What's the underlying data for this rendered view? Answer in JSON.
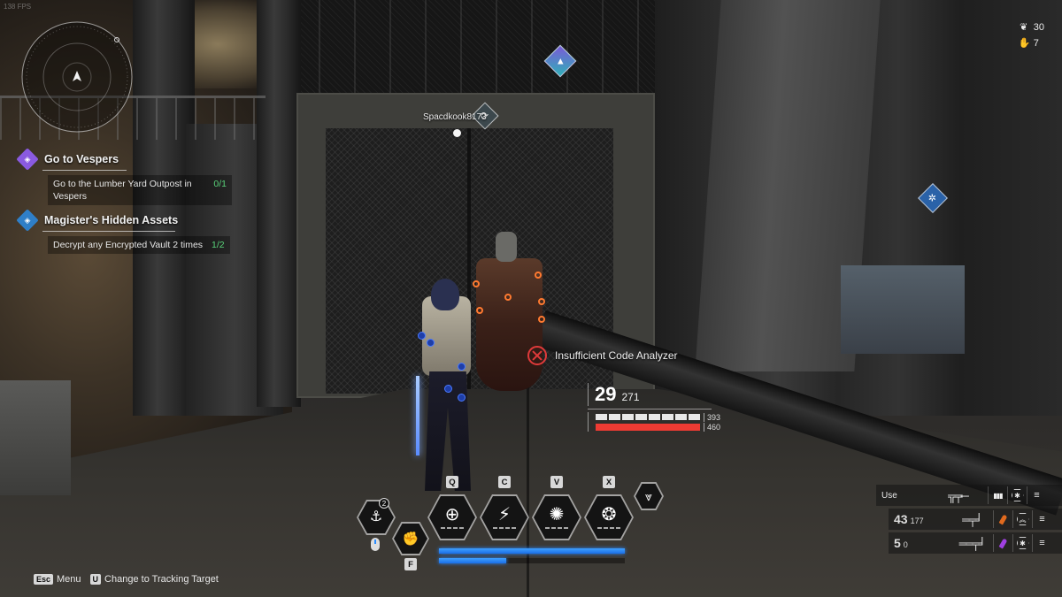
{
  "fps": {
    "label": "138 FPS"
  },
  "minimap": {
    "player_marker": "north-arrow-icon"
  },
  "quests": [
    {
      "icon": "main-quest-icon",
      "icon_color": "#8a5ae0",
      "title": "Go to Vespers",
      "objective": "Go to the Lumber Yard Outpost in Vespers",
      "progress": "0/1"
    },
    {
      "icon": "side-quest-icon",
      "icon_color": "#2f7fc8",
      "title": "Magister's Hidden Assets",
      "objective": "Decrypt any Encrypted Vault 2 times",
      "progress": "1/2"
    }
  ],
  "counters": [
    {
      "icon": "crest-icon",
      "glyph": "❦",
      "value": "30"
    },
    {
      "icon": "hand-icon",
      "glyph": "✋",
      "value": "7"
    }
  ],
  "waypoints": {
    "main": {
      "icon": "quest-waypoint-icon",
      "glyph": "▲"
    },
    "ally": {
      "icon": "ally-marker-icon",
      "glyph": "⟳"
    },
    "side": {
      "icon": "vault-waypoint-icon",
      "glyph": "✲"
    }
  },
  "player": {
    "name": "Spacdkook8173"
  },
  "notice": {
    "text": "Insufficient Code Analyzer",
    "icon": "blocked-icon"
  },
  "status": {
    "level": "29",
    "sub_value": "271",
    "shield": {
      "current": "393",
      "segments": 8,
      "fraction": 1.0
    },
    "hp": {
      "current": "460",
      "fraction": 1.0,
      "color": "#ee3b33"
    }
  },
  "skills": {
    "grapple": {
      "icon": "grapple-hook-icon",
      "glyph": "⚓",
      "charges": "2",
      "input": "mouse-icon"
    },
    "melee": {
      "icon": "fist-icon",
      "glyph": "✊",
      "key": "F"
    },
    "slots": [
      {
        "key": "Q",
        "icon": "crosshair-shield-icon",
        "glyph": "⊕"
      },
      {
        "key": "C",
        "icon": "lightning-heal-icon",
        "glyph": "⚡"
      },
      {
        "key": "V",
        "icon": "spiked-orb-icon",
        "glyph": "✺"
      },
      {
        "key": "X",
        "icon": "ultimate-burst-icon",
        "glyph": "❂"
      }
    ],
    "transcend": {
      "icon": "transcend-wing-icon",
      "glyph": "⩔"
    }
  },
  "resource_bars": [
    {
      "name": "mp",
      "fraction": 1.0
    },
    {
      "name": "sub",
      "fraction": 0.36
    }
  ],
  "hints": [
    {
      "key": "Esc",
      "label": "Menu"
    },
    {
      "key": "U",
      "label": "Change to Tracking Target"
    }
  ],
  "weapons": {
    "use": {
      "label": "Use",
      "icon": "launcher-icon",
      "glyph": "╦╤─",
      "ammo_icon": "ammo-box-icon",
      "ammo_glyph": "▮▮▮",
      "module_icon": "module-icon",
      "module_glyph": "✱"
    },
    "slots": [
      {
        "ammo": "43",
        "reserve": "177",
        "icon": "shotgun-icon",
        "glyph": "═╤╛",
        "ammo_color": "#e06a1e",
        "rank_icon": "rank-chevron-icon",
        "rank_glyph": "︽"
      },
      {
        "ammo": "5",
        "reserve": "0",
        "icon": "rifle-icon",
        "glyph": "══╤╛",
        "ammo_color": "#a040e0",
        "rank_icon": "module-icon",
        "rank_glyph": "✱"
      }
    ]
  }
}
